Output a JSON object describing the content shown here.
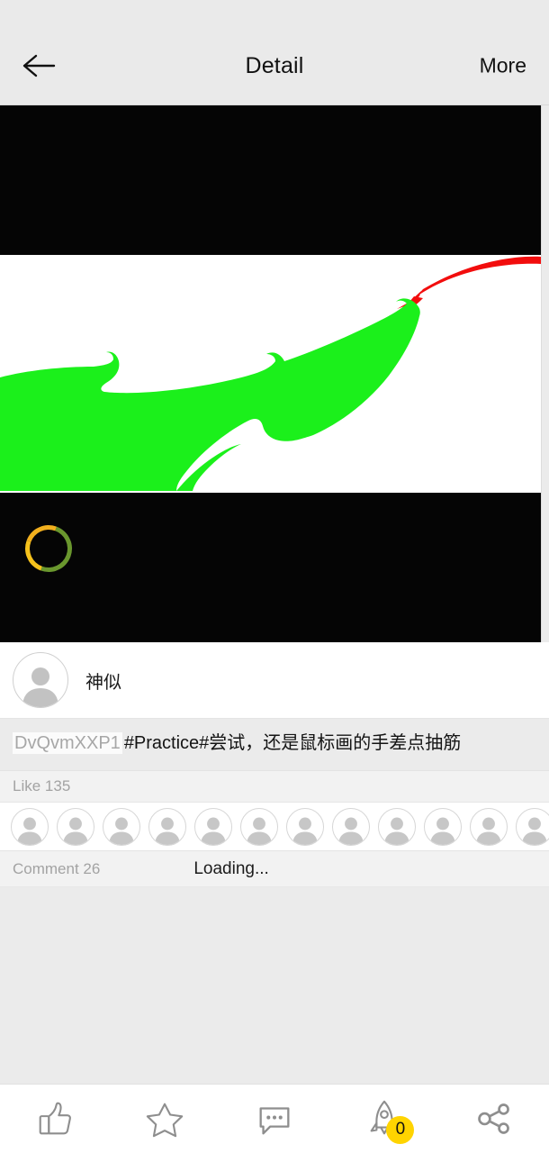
{
  "header": {
    "title": "Detail",
    "back_icon": "arrow-left-icon",
    "more_label": "More"
  },
  "media": {
    "background_color": "#050505",
    "canvas_color": "#ffffff",
    "artwork_green": "#1bf01b",
    "artwork_red": "#f20d0d",
    "loader": {
      "visible": true,
      "arc_color": "#f2b01e",
      "track_color": "#8cc83c"
    }
  },
  "author": {
    "name": "神似",
    "avatar_icon": "person-placeholder-icon"
  },
  "caption": {
    "tag": "DvQvmXXP1",
    "text": "#Practice#尝试，还是鼠标画的手差点抽筋"
  },
  "likes": {
    "label": "Like 135",
    "count": 135,
    "avatar_count": 12,
    "avatars": [
      "person-placeholder-icon",
      "person-placeholder-icon",
      "person-placeholder-icon",
      "person-placeholder-icon",
      "person-placeholder-icon",
      "person-placeholder-icon",
      "person-placeholder-icon",
      "person-placeholder-icon",
      "person-placeholder-icon",
      "person-placeholder-icon",
      "person-placeholder-icon",
      "person-placeholder-icon"
    ]
  },
  "comments": {
    "label": "Comment 26",
    "count": 26,
    "loading_text": "Loading..."
  },
  "toolbar": {
    "items": [
      {
        "name": "like",
        "icon": "thumbs-up-icon"
      },
      {
        "name": "favorite",
        "icon": "star-icon"
      },
      {
        "name": "comment",
        "icon": "comment-bubble-icon"
      },
      {
        "name": "boost",
        "icon": "rocket-icon",
        "badge": "0"
      },
      {
        "name": "share",
        "icon": "share-nodes-icon"
      }
    ],
    "badge_color": "#ffd400",
    "icon_color": "#8e8e8e"
  }
}
